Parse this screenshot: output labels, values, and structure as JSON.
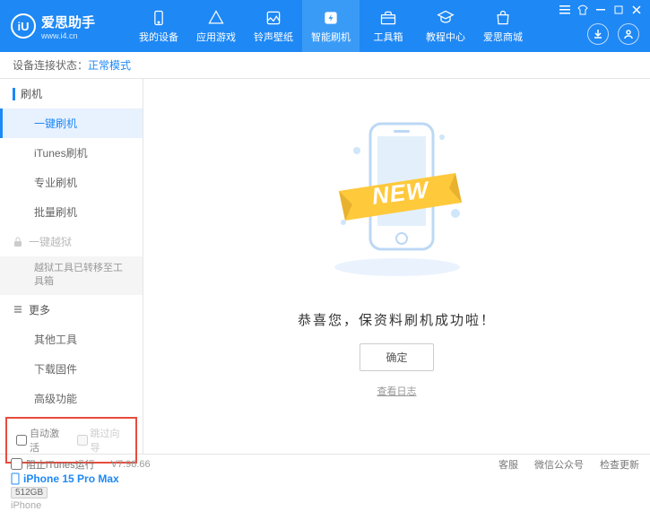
{
  "brand": {
    "logo_letter": "iU",
    "title": "爱思助手",
    "subtitle": "www.i4.cn"
  },
  "nav": {
    "items": [
      {
        "label": "我的设备"
      },
      {
        "label": "应用游戏"
      },
      {
        "label": "铃声壁纸"
      },
      {
        "label": "智能刷机"
      },
      {
        "label": "工具箱"
      },
      {
        "label": "教程中心"
      },
      {
        "label": "爱思商城"
      }
    ],
    "active_index": 3
  },
  "status": {
    "label": "设备连接状态：",
    "value": "正常模式"
  },
  "sidebar": {
    "flash": {
      "header": "刷机",
      "items": [
        "一键刷机",
        "iTunes刷机",
        "专业刷机",
        "批量刷机"
      ],
      "active_index": 0
    },
    "jailbreak": {
      "header": "一键越狱",
      "note": "越狱工具已转移至工具箱"
    },
    "more": {
      "header": "更多",
      "items": [
        "其他工具",
        "下载固件",
        "高级功能"
      ]
    },
    "checkboxes": {
      "auto_activate": "自动激活",
      "skip_guide": "跳过向导"
    },
    "device": {
      "name": "iPhone 15 Pro Max",
      "storage": "512GB",
      "type": "iPhone"
    }
  },
  "main": {
    "new_badge": "NEW",
    "success_text": "恭喜您，保资料刷机成功啦！",
    "ok_button": "确定",
    "log_link": "查看日志"
  },
  "footer": {
    "block_itunes": "阻止iTunes运行",
    "version": "V7.98.66",
    "links": [
      "客服",
      "微信公众号",
      "检查更新"
    ]
  }
}
